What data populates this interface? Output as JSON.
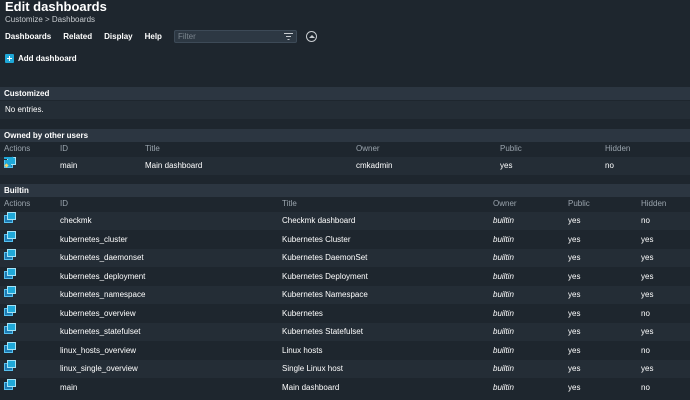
{
  "header": {
    "title": "Edit dashboards",
    "breadcrumb": "Customize > Dashboards"
  },
  "menubar": {
    "items": [
      "Dashboards",
      "Related",
      "Display",
      "Help"
    ],
    "filter_placeholder": "Filter"
  },
  "actions": {
    "add_dashboard_label": "Add dashboard"
  },
  "customized": {
    "title": "Customized",
    "empty_text": "No entries."
  },
  "owned": {
    "title": "Owned by other users",
    "columns": {
      "actions": "Actions",
      "id": "ID",
      "title": "Title",
      "owner": "Owner",
      "public": "Public",
      "hidden": "Hidden"
    },
    "rows": [
      {
        "id": "main",
        "title": "Main dashboard",
        "owner": "cmkadmin",
        "public": "yes",
        "hidden": "no"
      }
    ]
  },
  "builtin": {
    "title": "Builtin",
    "columns": {
      "actions": "Actions",
      "id": "ID",
      "title": "Title",
      "owner": "Owner",
      "public": "Public",
      "hidden": "Hidden"
    },
    "rows": [
      {
        "id": "checkmk",
        "title": "Checkmk dashboard",
        "owner": "builtin",
        "public": "yes",
        "hidden": "no"
      },
      {
        "id": "kubernetes_cluster",
        "title": "Kubernetes Cluster",
        "owner": "builtin",
        "public": "yes",
        "hidden": "yes"
      },
      {
        "id": "kubernetes_daemonset",
        "title": "Kubernetes DaemonSet",
        "owner": "builtin",
        "public": "yes",
        "hidden": "yes"
      },
      {
        "id": "kubernetes_deployment",
        "title": "Kubernetes Deployment",
        "owner": "builtin",
        "public": "yes",
        "hidden": "yes"
      },
      {
        "id": "kubernetes_namespace",
        "title": "Kubernetes Namespace",
        "owner": "builtin",
        "public": "yes",
        "hidden": "yes"
      },
      {
        "id": "kubernetes_overview",
        "title": "Kubernetes",
        "owner": "builtin",
        "public": "yes",
        "hidden": "no"
      },
      {
        "id": "kubernetes_statefulset",
        "title": "Kubernetes Statefulset",
        "owner": "builtin",
        "public": "yes",
        "hidden": "yes"
      },
      {
        "id": "linux_hosts_overview",
        "title": "Linux hosts",
        "owner": "builtin",
        "public": "yes",
        "hidden": "no"
      },
      {
        "id": "linux_single_overview",
        "title": "Single Linux host",
        "owner": "builtin",
        "public": "yes",
        "hidden": "yes"
      },
      {
        "id": "main",
        "title": "Main dashboard",
        "owner": "builtin",
        "public": "yes",
        "hidden": "no"
      }
    ]
  },
  "icons": {
    "clone": "clone-icon",
    "delete": "trash-icon",
    "edit": "pencil-icon",
    "filter": "filter-icon",
    "collapse": "chevron-up-icon",
    "add": "plus-icon"
  },
  "colors": {
    "background": "#1e262e",
    "section_header": "#2c3641",
    "accent": "#1fa8d8"
  }
}
